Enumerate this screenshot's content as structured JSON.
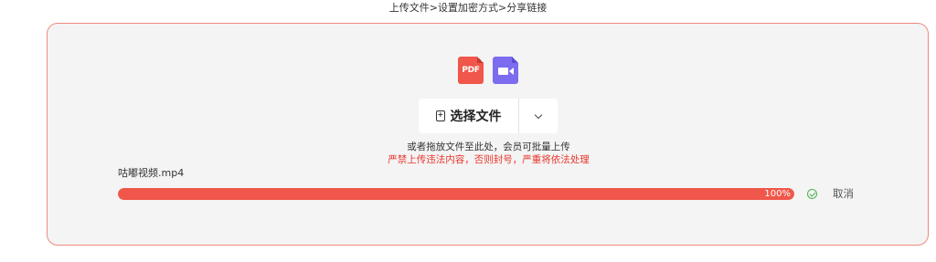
{
  "header": {
    "steps_text": "上传文件>设置加密方式>分享链接"
  },
  "upload": {
    "icons": [
      {
        "name": "pdf-file-icon",
        "label": "PDF",
        "color": "#f0564a"
      },
      {
        "name": "video-file-icon",
        "color": "#7c6cf0"
      }
    ],
    "select_button_label": "选择文件",
    "hint_text": "或者拖放文件至此处，会员可批量上传",
    "warning_text": "严禁上传违法内容，否则封号，严重将依法处理",
    "accent_color": "#f0564a",
    "border_color": "#f08a7e"
  },
  "file": {
    "name": "咕嘟视频.mp4",
    "progress": 100,
    "progress_label": "100%",
    "status_icon": "check-circle-icon",
    "cancel_label": "取消"
  }
}
